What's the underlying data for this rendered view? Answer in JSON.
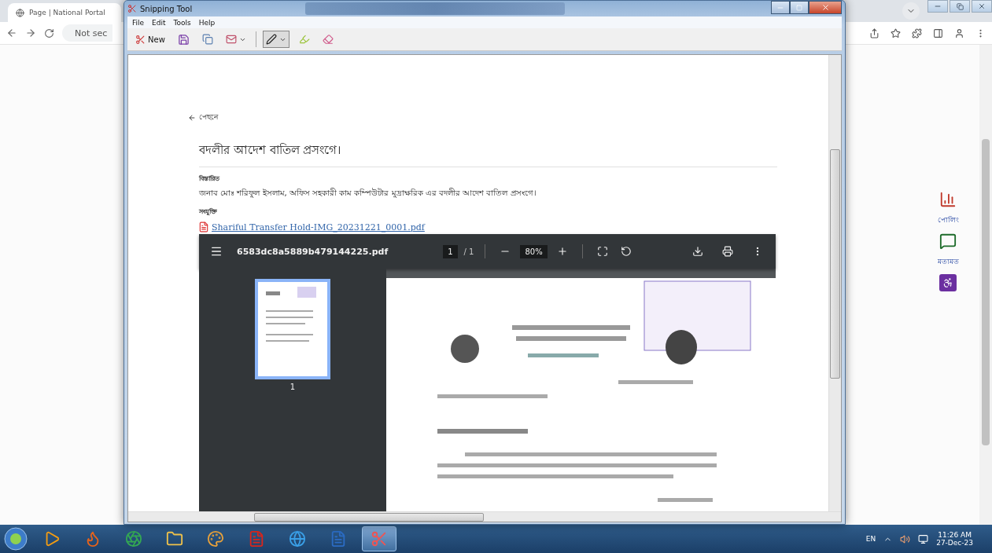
{
  "browser": {
    "tab_title": "Page | National Portal",
    "address_text": "Not sec",
    "side_widgets": [
      {
        "kind": "poll",
        "label": "পোলিং"
      },
      {
        "kind": "feedback",
        "label": "মতামত"
      },
      {
        "kind": "accessibility"
      }
    ]
  },
  "snipping_tool": {
    "title": "Snipping Tool",
    "menu": [
      "File",
      "Edit",
      "Tools",
      "Help"
    ],
    "new_label": "New",
    "page": {
      "back_label": "পেছনে",
      "title": "বদলীর আদেশ বাতিল প্রসংগে।",
      "details_label": "বিস্তারিত",
      "details_text": "জনাব মোঃ শরিফুল ইসলাম, অফিস সহকারী কাম কম্পিউটার মুদ্রাক্ষরিক  এর বদলীর আদেশ বাতিল প্রসংগে।",
      "attachment_label": "সংযুক্তি",
      "attachment_link": "Shariful Transfer Hold-IMG_20231221_0001.pdf",
      "pdf_viewer": {
        "filename": "6583dc8a5889b479144225.pdf",
        "page_current": "1",
        "page_total": "/ 1",
        "zoom": "80%",
        "thumbnails": [
          {
            "label": "1",
            "selected": true
          }
        ]
      }
    }
  },
  "taskbar": {
    "apps": [
      {
        "kind": "media",
        "selected": false
      },
      {
        "kind": "firefox",
        "selected": false
      },
      {
        "kind": "chrome",
        "selected": false
      },
      {
        "kind": "folder",
        "selected": false
      },
      {
        "kind": "paint",
        "selected": false
      },
      {
        "kind": "pdf",
        "selected": false
      },
      {
        "kind": "ie",
        "selected": false
      },
      {
        "kind": "word",
        "selected": false
      },
      {
        "kind": "snip",
        "selected": true
      }
    ],
    "language": "EN",
    "time": "11:26 AM",
    "date": "27-Dec-23"
  }
}
